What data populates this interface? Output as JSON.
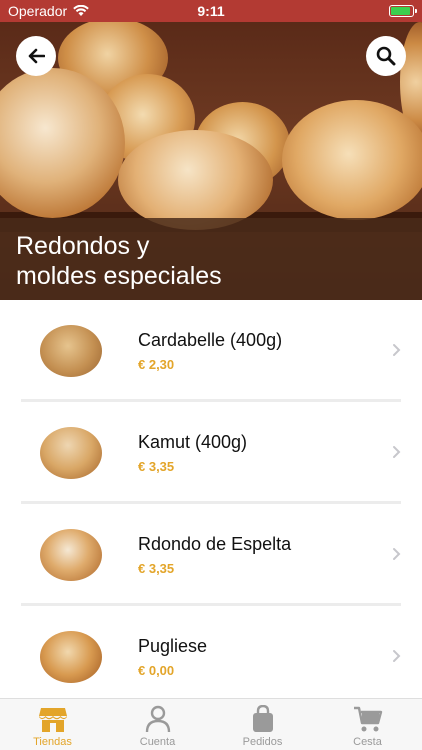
{
  "status_bar": {
    "carrier": "Operador",
    "time": "9:11",
    "battery_level": 0.9
  },
  "header": {
    "title_line1": "Redondos y",
    "title_line2": "moldes especiales",
    "back_icon": "arrow-left-icon",
    "search_icon": "search-icon"
  },
  "products": [
    {
      "name": "Cardabelle (400g)",
      "price": "€ 2,30"
    },
    {
      "name": "Kamut (400g)",
      "price": "€ 3,35"
    },
    {
      "name": "Rdondo de Espelta",
      "price": "€ 3,35"
    },
    {
      "name": "Pugliese",
      "price": "€ 0,00"
    }
  ],
  "tabbar": {
    "tabs": [
      {
        "label": "Tiendas",
        "icon": "store-icon",
        "active": true
      },
      {
        "label": "Cuenta",
        "icon": "user-icon",
        "active": false
      },
      {
        "label": "Pedidos",
        "icon": "bag-icon",
        "active": false
      },
      {
        "label": "Cesta",
        "icon": "cart-icon",
        "active": false
      }
    ]
  },
  "colors": {
    "status_bar": "#b33a33",
    "accent": "#e3a52a",
    "inactive": "#9a9a9a"
  }
}
